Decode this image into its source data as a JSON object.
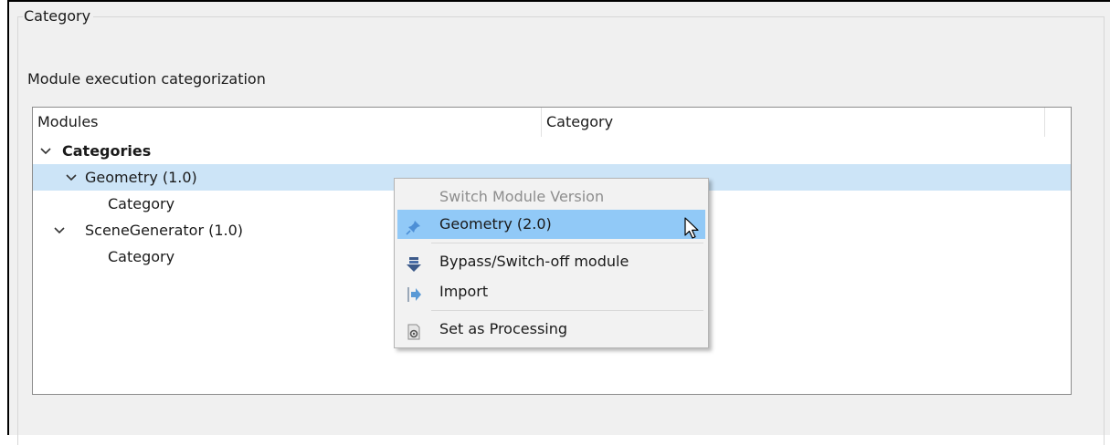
{
  "group": {
    "title": "Category"
  },
  "section": {
    "label": "Module execution categorization"
  },
  "tree": {
    "columns": [
      "Modules",
      "Category"
    ],
    "rows": [
      {
        "label": "Categories",
        "bold": true,
        "expanded": true
      },
      {
        "label": "Geometry (1.0)",
        "expanded": true,
        "selected": true
      },
      {
        "label": "Category"
      },
      {
        "label": "SceneGenerator (1.0)",
        "expanded": true
      },
      {
        "label": "Category"
      }
    ]
  },
  "context_menu": {
    "items": [
      {
        "label": "Switch Module Version",
        "disabled": true
      },
      {
        "label": "Geometry (2.0)",
        "icon": "pin-icon",
        "highlighted": true
      },
      {
        "label": "Bypass/Switch-off module",
        "icon": "down-arrow-icon"
      },
      {
        "label": "Import",
        "icon": "import-icon"
      },
      {
        "label": "Set as Processing",
        "icon": "processing-icon"
      }
    ]
  },
  "colors": {
    "selection": "#cce4f7",
    "menu_highlight": "#91c9f7",
    "panel_bg": "#f0f0f0"
  }
}
